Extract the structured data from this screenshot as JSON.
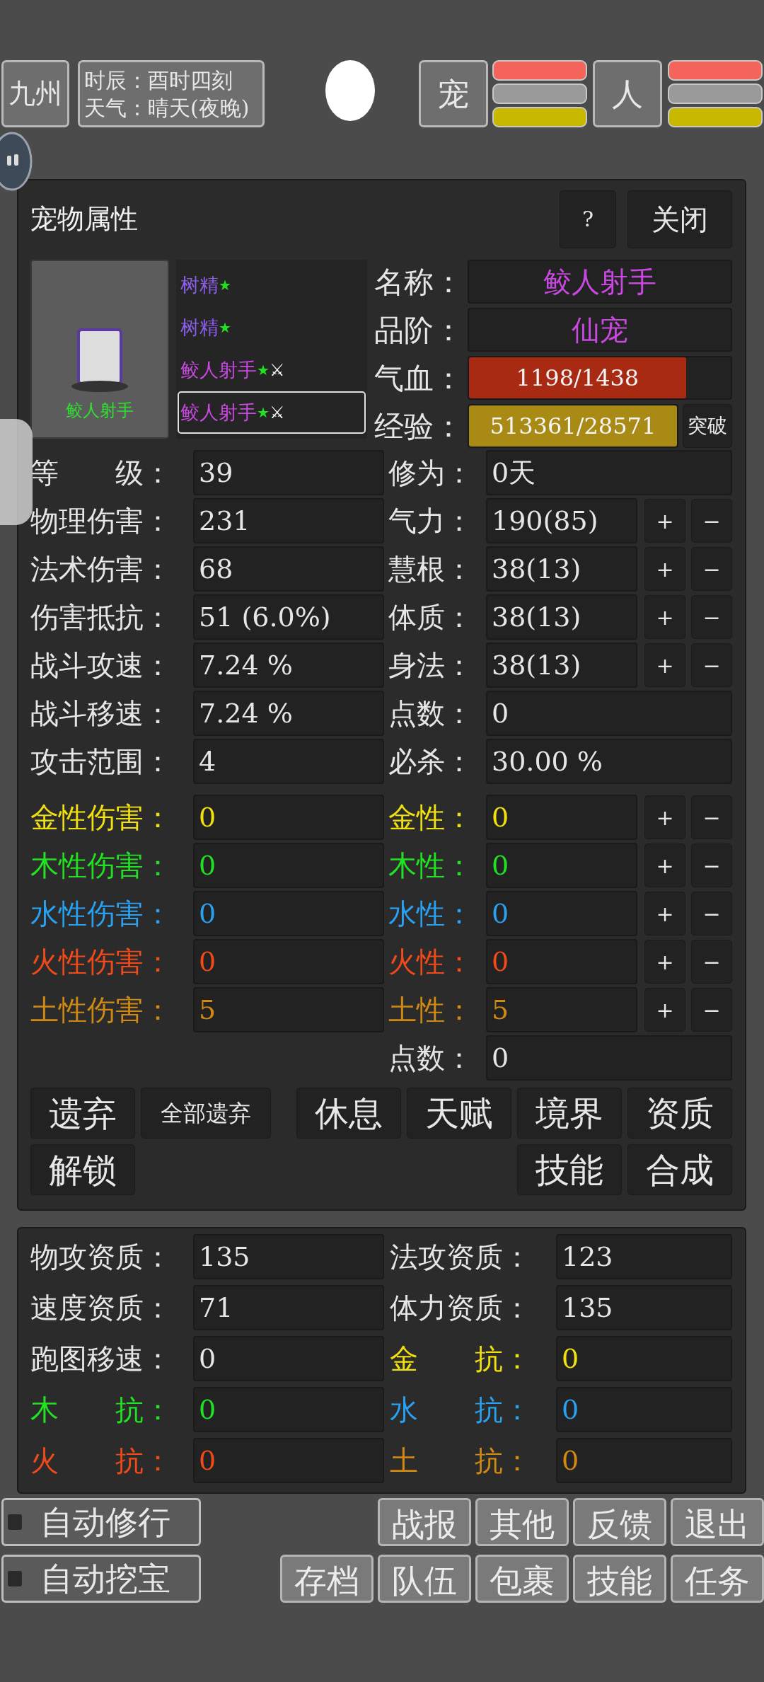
{
  "top_bar": {
    "region": "九州",
    "time_label": "时辰：",
    "time": "酉时四刻",
    "weather_label": "天气：",
    "weather": "晴天(夜晚)",
    "pet_button": "宠",
    "pet_bars": [
      {
        "color": "#f4645a"
      },
      {
        "color": "#9a9a9a"
      },
      {
        "color": "#c8b800"
      }
    ],
    "person_button": "人",
    "person_bars": [
      {
        "color": "#f4645a"
      },
      {
        "color": "#9a9a9a"
      },
      {
        "color": "#c8b800"
      }
    ]
  },
  "pet_panel": {
    "title": "宠物属性",
    "help_button": "?",
    "close_button": "关闭",
    "portrait_name": "鲛人射手",
    "pets": [
      {
        "name": "树精",
        "star": "★",
        "color": "#8a5ee8",
        "selected": false
      },
      {
        "name": "树精",
        "star": "★",
        "color": "#8a5ee8",
        "selected": false
      },
      {
        "name": "鲛人射手",
        "star": "★",
        "swords": "⚔",
        "color": "#c848e0",
        "selected": false
      },
      {
        "name": "鲛人射手",
        "star": "★",
        "swords": "⚔",
        "color": "#c848e0",
        "selected": true
      }
    ],
    "info": [
      {
        "kind": "text",
        "label": "名称：",
        "value": "鲛人射手",
        "color": "#c848e0"
      },
      {
        "kind": "text",
        "label": "品阶：",
        "value": "仙宠",
        "color": "#c848e0"
      },
      {
        "kind": "bar",
        "label": "气血：",
        "value": "1198/1438",
        "level": 0.83,
        "color": "#a82a12"
      },
      {
        "kind": "bar",
        "label": "经验：",
        "value": "513361/28571",
        "level": 1,
        "color": "#a88a14",
        "button": "突破"
      }
    ],
    "stats": [
      {
        "label": "等　　级：",
        "value": "39",
        "right_label": "修为：",
        "right_value": "0天",
        "adjustable": false
      },
      {
        "label": "物理伤害：",
        "value": "231",
        "right_label": "气力：",
        "right_value": "190(85)",
        "adjustable": true,
        "plus": "+",
        "minus": "−"
      },
      {
        "label": "法术伤害：",
        "value": "68",
        "right_label": "慧根：",
        "right_value": "38(13)",
        "adjustable": true,
        "plus": "+",
        "minus": "−"
      },
      {
        "label": "伤害抵抗：",
        "value": "51 (6.0%)",
        "right_label": "体质：",
        "right_value": "38(13)",
        "adjustable": true,
        "plus": "+",
        "minus": "−"
      },
      {
        "label": "战斗攻速：",
        "value": "7.24 %",
        "right_label": "身法：",
        "right_value": "38(13)",
        "adjustable": true,
        "plus": "+",
        "minus": "−"
      },
      {
        "label": "战斗移速：",
        "value": "7.24 %",
        "right_label": "点数：",
        "right_value": "0",
        "adjustable": false
      },
      {
        "label": "攻击范围：",
        "value": "4",
        "right_label": "必杀：",
        "right_value": "30.00 %",
        "adjustable": false
      }
    ],
    "element_stats": [
      {
        "label": "金性伤害：",
        "value": "0",
        "right_label": "金性：",
        "right_value": "0",
        "color": "#f0e010",
        "adjustable": true,
        "plus": "+",
        "minus": "−"
      },
      {
        "label": "木性伤害：",
        "value": "0",
        "right_label": "木性：",
        "right_value": "0",
        "color": "#22e022",
        "adjustable": true,
        "plus": "+",
        "minus": "−"
      },
      {
        "label": "水性伤害：",
        "value": "0",
        "right_label": "水性：",
        "right_value": "0",
        "color": "#2aa0f0",
        "adjustable": true,
        "plus": "+",
        "minus": "−"
      },
      {
        "label": "火性伤害：",
        "value": "0",
        "right_label": "火性：",
        "right_value": "0",
        "color": "#f04a1a",
        "adjustable": true,
        "plus": "+",
        "minus": "−"
      },
      {
        "label": "土性伤害：",
        "value": "5",
        "right_label": "土性：",
        "right_value": "5",
        "color": "#d08a14",
        "adjustable": true,
        "plus": "+",
        "minus": "−"
      },
      {
        "right_label": "点数：",
        "right_value": "0",
        "adjustable": false
      }
    ],
    "actions_left": [
      [
        "遗弃",
        "全部遗弃"
      ],
      [
        "解锁"
      ]
    ],
    "actions_right": [
      [
        "休息",
        "天赋",
        "境界",
        "资质"
      ],
      [
        "技能",
        "合成"
      ]
    ]
  },
  "aptitude_panel": {
    "rows": [
      {
        "left": {
          "label": "物攻资质：",
          "value": "135"
        },
        "right": {
          "label": "法攻资质：",
          "value": "123"
        }
      },
      {
        "left": {
          "label": "速度资质：",
          "value": "71"
        },
        "right": {
          "label": "体力资质：",
          "value": "135"
        }
      },
      {
        "left": {
          "label": "跑图移速：",
          "value": "0"
        },
        "right": {
          "label": "金　　抗：",
          "value": "0",
          "color": "#f0e010"
        }
      },
      {
        "left": {
          "label": "木　　抗：",
          "value": "0",
          "color": "#22e022"
        },
        "right": {
          "label": "水　　抗：",
          "value": "0",
          "color": "#2aa0f0"
        }
      },
      {
        "left": {
          "label": "火　　抗：",
          "value": "0",
          "color": "#f04a1a"
        },
        "right": {
          "label": "土　　抗：",
          "value": "0",
          "color": "#d08a14"
        }
      }
    ]
  },
  "bottom": {
    "toggles": [
      {
        "label": "自动修行",
        "checked": false
      },
      {
        "label": "自动挖宝",
        "checked": false
      }
    ],
    "menu_rows": [
      [
        "战报",
        "其他",
        "反馈",
        "退出"
      ],
      [
        "存档",
        "队伍",
        "包裹",
        "技能",
        "任务"
      ]
    ]
  }
}
